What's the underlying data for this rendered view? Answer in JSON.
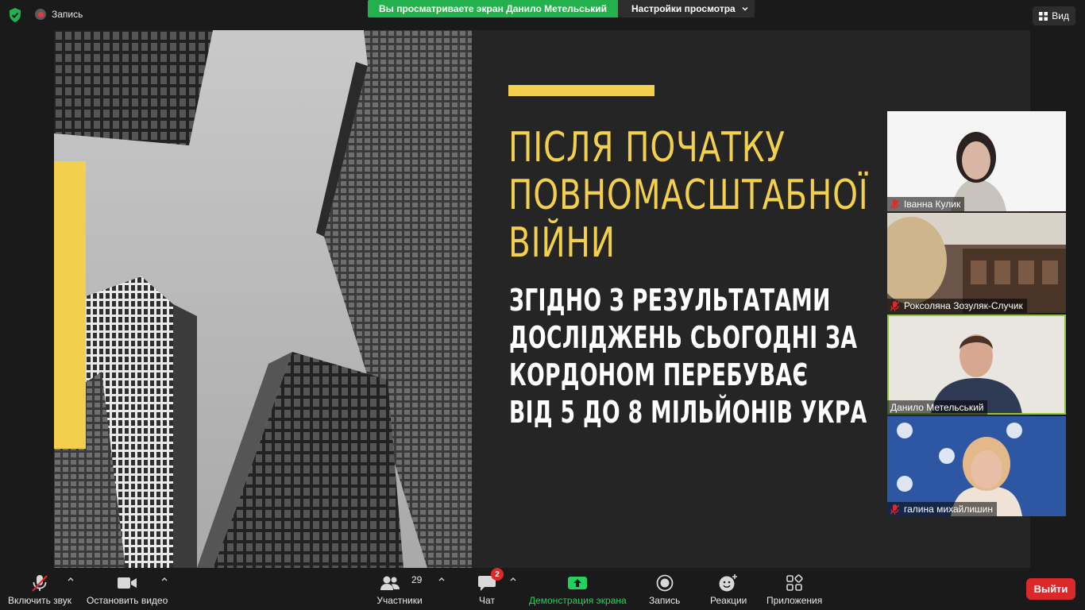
{
  "top_bar": {
    "record_label": "Запись",
    "share_banner_text": "Вы просматриваете экран Данило Метельський",
    "view_settings_label": "Настройки просмотра",
    "view_label": "Вид"
  },
  "slide": {
    "headline": [
      "ПІСЛЯ ПОЧАТКУ",
      "ПОВНОМАСШТАБНОЇ",
      "ВІЙНИ"
    ],
    "body": [
      "ЗГІДНО З РЕЗУЛЬТАТАМИ",
      "ДОСЛІДЖЕНЬ СЬОГОДНІ ЗА",
      "КОРДОНОМ ПЕРЕБУВАЄ",
      "ВІД 5 ДО 8 МІЛЬЙОНІВ УКРА"
    ],
    "accent_color": "#f2cf4d"
  },
  "participants": [
    {
      "name": "Іванна Кулик",
      "muted": true
    },
    {
      "name": "Роксоляна Зозуляк-Случик",
      "muted": true
    },
    {
      "name": "Данило Метельський",
      "muted": false,
      "active": true
    },
    {
      "name": "галина михайлишин",
      "muted": true
    }
  ],
  "toolbar": {
    "unmute_label": "Включить звук",
    "stop_video_label": "Остановить видео",
    "participants_label": "Участники",
    "participants_count": "29",
    "chat_label": "Чат",
    "chat_badge": "2",
    "share_label": "Демонстрация экрана",
    "record_label": "Запись",
    "reactions_label": "Реакции",
    "apps_label": "Приложения",
    "leave_label": "Выйти"
  }
}
